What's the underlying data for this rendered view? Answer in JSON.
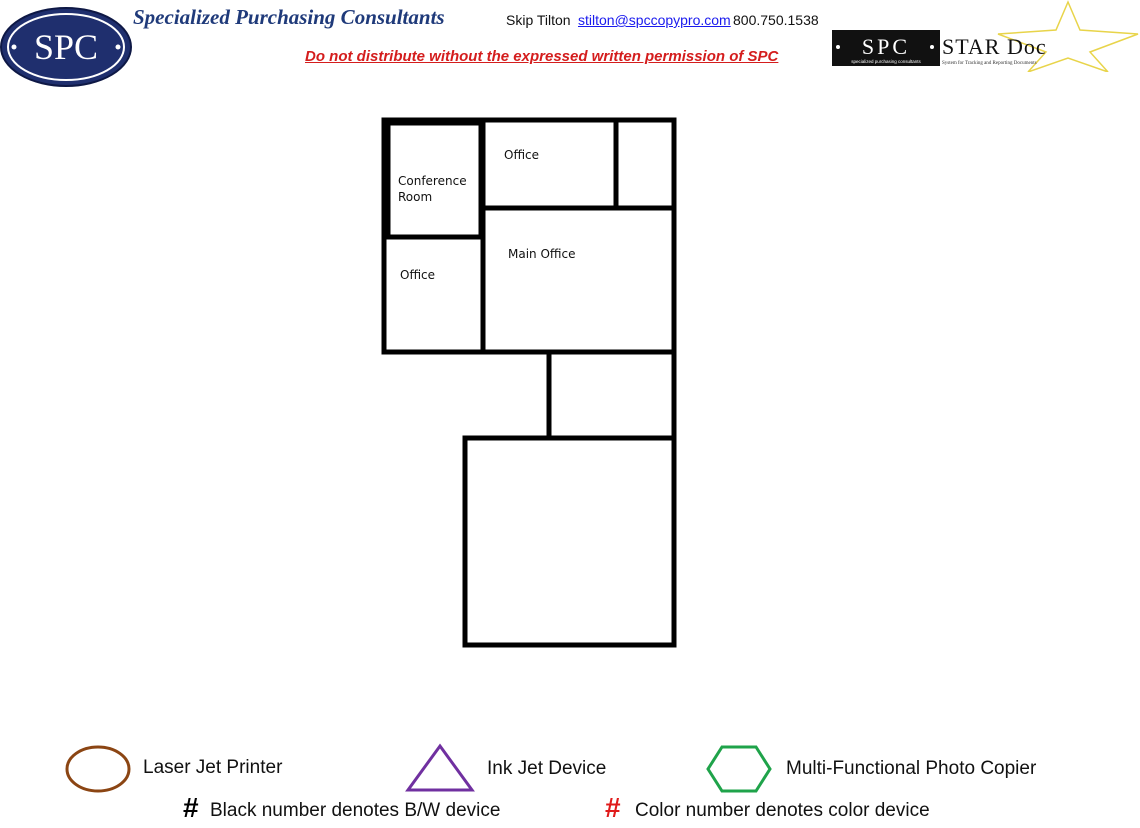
{
  "header": {
    "logo_text": "SPC",
    "company_name": "Specialized Purchasing Consultants",
    "contact_name": "Skip Tilton",
    "contact_email": "stilton@spccopypro.com",
    "contact_phone": "800.750.1538",
    "warning": "Do not distribute without the expressed written permission of SPC",
    "stardoc": {
      "spc_text": "SPC",
      "tagline_left": "specialized purchasing consultants",
      "title": "STAR Doc",
      "tagline_right": "System for Tracking and Reporting Documents"
    }
  },
  "floorplan": {
    "rooms": [
      {
        "label_lines": [
          "Conference",
          "Room"
        ]
      },
      {
        "label_lines": [
          "Office"
        ]
      },
      {
        "label_lines": [
          "Office"
        ]
      },
      {
        "label_lines": [
          "Main Office"
        ]
      }
    ]
  },
  "legend": {
    "laser": "Laser Jet Printer",
    "inkjet": "Ink Jet Device",
    "mfp": "Multi-Functional Photo Copier",
    "hash_symbol": "#",
    "bw_note": "Black number denotes B/W device",
    "color_note": "Color number denotes color device"
  },
  "colors": {
    "laser": "#8b4513",
    "inkjet": "#7030a0",
    "mfp": "#1fa34a",
    "color_hash": "#e01b1b",
    "brand_navy": "#1f2f6e"
  }
}
